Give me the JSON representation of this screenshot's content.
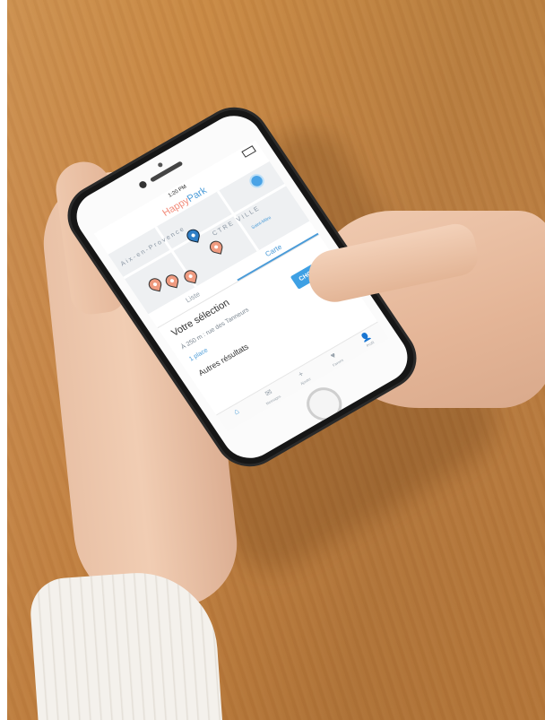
{
  "status_bar": {
    "time": "1:20 PM"
  },
  "app": {
    "logo_part1": "Happy",
    "logo_part2": "Park"
  },
  "map": {
    "city_label": "Aix-en-Provence",
    "district_label": "CTRE VILLE",
    "street_label": "Saint-Mitre",
    "pin_count_orange": 4,
    "pin_count_blue": 1
  },
  "tabs": [
    {
      "label": "Liste",
      "active": false
    },
    {
      "label": "Carte",
      "active": true
    }
  ],
  "selection": {
    "title": "Votre sélection",
    "address": "À 250 m : rue des Tanneurs",
    "places": "1 place",
    "choose_label": "CHOISIR"
  },
  "other_results_title": "Autres résultats",
  "tabbar": [
    {
      "icon": "home-icon",
      "glyph": "⌂",
      "label": "",
      "active": true
    },
    {
      "icon": "mail-icon",
      "glyph": "✉",
      "label": "Messages",
      "active": false
    },
    {
      "icon": "plus-icon",
      "glyph": "+",
      "label": "Ajouter",
      "active": false
    },
    {
      "icon": "heart-icon",
      "glyph": "♥",
      "label": "Favoris",
      "active": false
    },
    {
      "icon": "user-icon",
      "glyph": "👤",
      "label": "Profil",
      "active": false
    }
  ],
  "colors": {
    "accent_blue": "#4a9bd8",
    "accent_orange": "#f28b7a",
    "button_blue": "#3ea0e4",
    "table_wood": "#c68545"
  }
}
